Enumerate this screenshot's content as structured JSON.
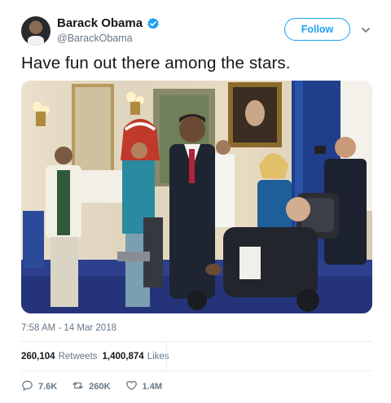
{
  "user": {
    "display_name": "Barack Obama",
    "handle": "@BarackObama",
    "verified": true
  },
  "follow_label": "Follow",
  "tweet": {
    "text": "Have fun out there among the stars.",
    "timestamp": "7:58 AM - 14 Mar 2018"
  },
  "stats": {
    "retweets_count": "260,104",
    "retweets_label": "Retweets",
    "likes_count": "1,400,874",
    "likes_label": "Likes"
  },
  "actions": {
    "reply_count": "7.6K",
    "retweet_count": "260K",
    "like_count": "1.4M"
  },
  "colors": {
    "accent": "#1da1f2",
    "text": "#14171a",
    "muted": "#657786",
    "divider": "#e6ecf0"
  },
  "icons": [
    "verified-badge-icon",
    "chevron-down-icon",
    "reply-icon",
    "retweet-icon",
    "heart-icon"
  ]
}
